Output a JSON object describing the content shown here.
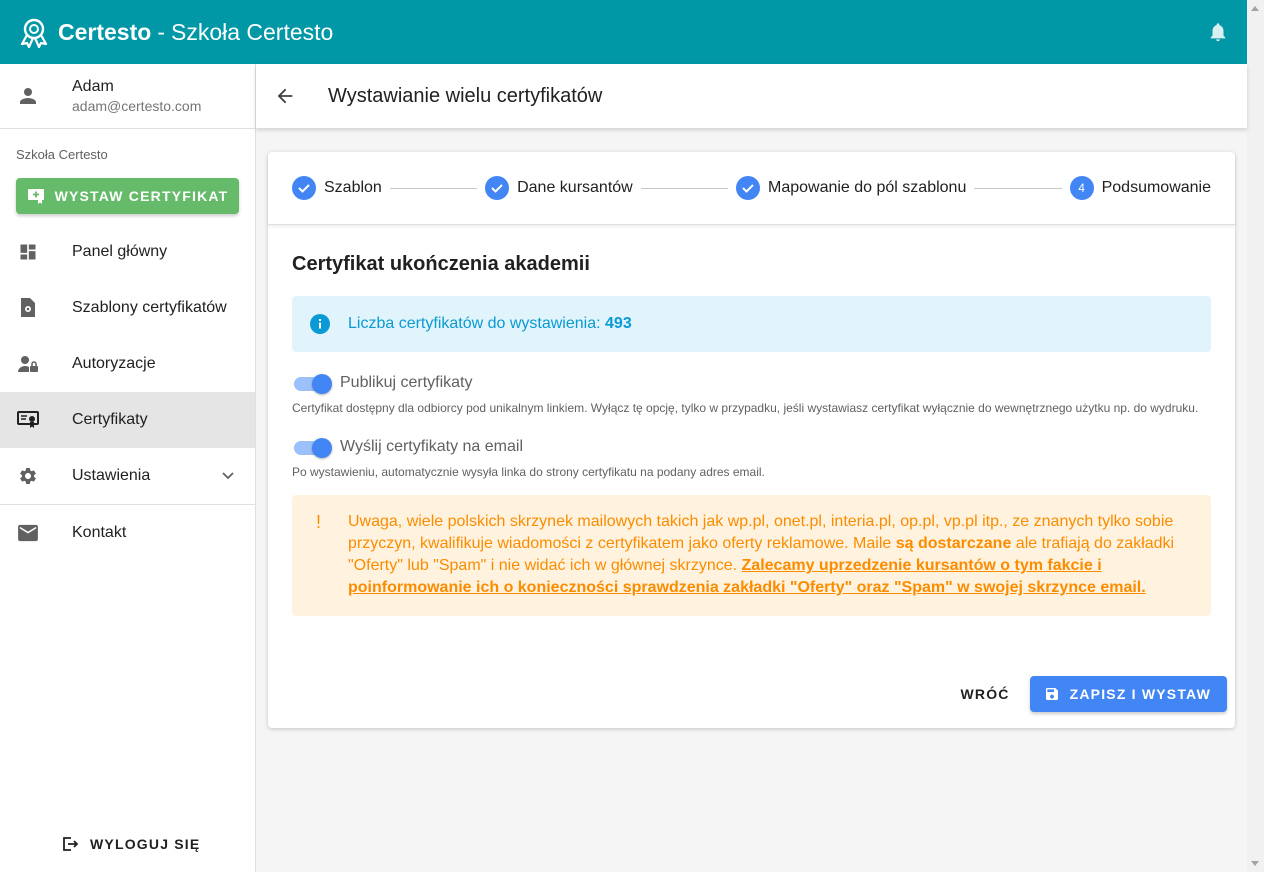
{
  "appbar": {
    "brand": "Certesto",
    "separator": "-",
    "school": "Szkoła Certesto"
  },
  "user": {
    "name": "Adam",
    "email": "adam@certesto.com"
  },
  "sidebar": {
    "school_label": "Szkoła Certesto",
    "issue_button": "WYSTAW CERTYFIKAT",
    "items": [
      {
        "label": "Panel główny",
        "icon": "dashboard-icon"
      },
      {
        "label": "Szablony certyfikatów",
        "icon": "template-icon"
      },
      {
        "label": "Autoryzacje",
        "icon": "user-lock-icon"
      },
      {
        "label": "Certyfikaty",
        "icon": "certificate-icon",
        "active": true
      },
      {
        "label": "Ustawienia",
        "icon": "gear-icon"
      },
      {
        "label": "Kontakt",
        "icon": "mail-icon"
      }
    ],
    "logout": "WYLOGUJ SIĘ"
  },
  "header": {
    "title": "Wystawianie wielu certyfikatów"
  },
  "stepper": {
    "steps": [
      {
        "label": "Szablon",
        "state": "done"
      },
      {
        "label": "Dane kursantów",
        "state": "done"
      },
      {
        "label": "Mapowanie do pól szablonu",
        "state": "done"
      },
      {
        "label": "Podsumowanie",
        "state": "active",
        "number": "4"
      }
    ]
  },
  "summary": {
    "title": "Certyfikat ukończenia akademii",
    "info_text": "Liczba certyfikatów do wystawienia:",
    "info_count": "493",
    "publish_label": "Publikuj certyfikaty",
    "publish_hint": "Certyfikat dostępny dla odbiorcy pod unikalnym linkiem. Wyłącz tę opcję, tylko w przypadku, jeśli wystawiasz certyfikat wyłącznie do wewnętrznego użytku np. do wydruku.",
    "email_label": "Wyślij certyfikaty na email",
    "email_hint": "Po wystawieniu, automatycznie wysyła linka do strony certyfikatu na podany adres email.",
    "warning_part1": "Uwaga, wiele polskich skrzynek mailowych takich jak wp.pl, onet.pl, interia.pl, op.pl, vp.pl itp., ze znanych tylko sobie przyczyn, kwalifikuje wiadomości z certyfikatem jako oferty reklamowe. Maile ",
    "warning_bold": "są dostarczane",
    "warning_part2": " ale trafiają do zakładki \"Oferty\" lub \"Spam\" i nie widać ich w głównej skrzynce. ",
    "warning_underline": "Zalecamy uprzedzenie kursantów o tym fakcie i poinformowanie ich o konieczności sprawdzenia zakładki \"Oferty\" oraz \"Spam\" w swojej skrzynce email.",
    "warning_mark": "!"
  },
  "actions": {
    "back": "WRÓĆ",
    "save": "ZAPISZ I WYSTAW"
  },
  "colors": {
    "appbar": "#0097a7",
    "primary": "#4285f4",
    "success": "#66bb6a",
    "info_bg": "#e1f4fb",
    "warn_bg": "#fff3e0",
    "warn_text": "#fb8c00"
  }
}
